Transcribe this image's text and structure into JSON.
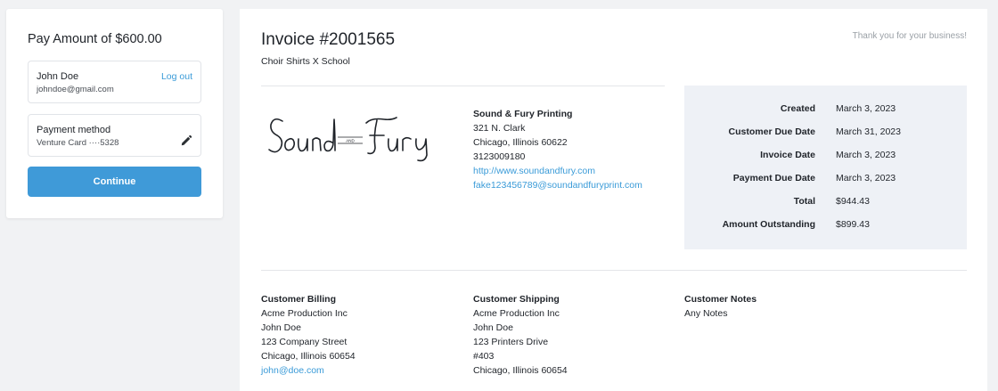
{
  "pay": {
    "title": "Pay Amount of $600.00",
    "user_name": "John Doe",
    "user_email": "johndoe@gmail.com",
    "logout_label": "Log out",
    "payment_method_title": "Payment method",
    "payment_method_value": "Venture Card ····5328",
    "continue_label": "Continue"
  },
  "invoice": {
    "title": "Invoice #2001565",
    "subtitle": "Choir Shirts X School",
    "thanks": "Thank you for your business!",
    "logo_text": "Sound and Fury",
    "company": {
      "name": "Sound & Fury Printing",
      "street": "321 N. Clark",
      "city": "Chicago, Illinois 60622",
      "phone": "3123009180",
      "website": "http://www.soundandfury.com",
      "email": "fake123456789@soundandfuryprint.com"
    },
    "summary": [
      {
        "label": "Created",
        "value": "March 3, 2023"
      },
      {
        "label": "Customer Due Date",
        "value": "March 31, 2023"
      },
      {
        "label": "Invoice Date",
        "value": "March 3, 2023"
      },
      {
        "label": "Payment Due Date",
        "value": "March 3, 2023"
      },
      {
        "label": "Total",
        "value": "$944.43"
      },
      {
        "label": "Amount Outstanding",
        "value": "$899.43"
      }
    ],
    "billing": {
      "heading": "Customer Billing",
      "company": "Acme Production Inc",
      "name": "John Doe",
      "street": "123 Company Street",
      "city": "Chicago, Illinois 60654",
      "email": "john@doe.com"
    },
    "shipping": {
      "heading": "Customer Shipping",
      "company": "Acme Production Inc",
      "name": "John Doe",
      "street": "123 Printers Drive",
      "unit": "#403",
      "city": "Chicago, Illinois 60654"
    },
    "notes": {
      "heading": "Customer Notes",
      "text": "Any Notes"
    }
  }
}
